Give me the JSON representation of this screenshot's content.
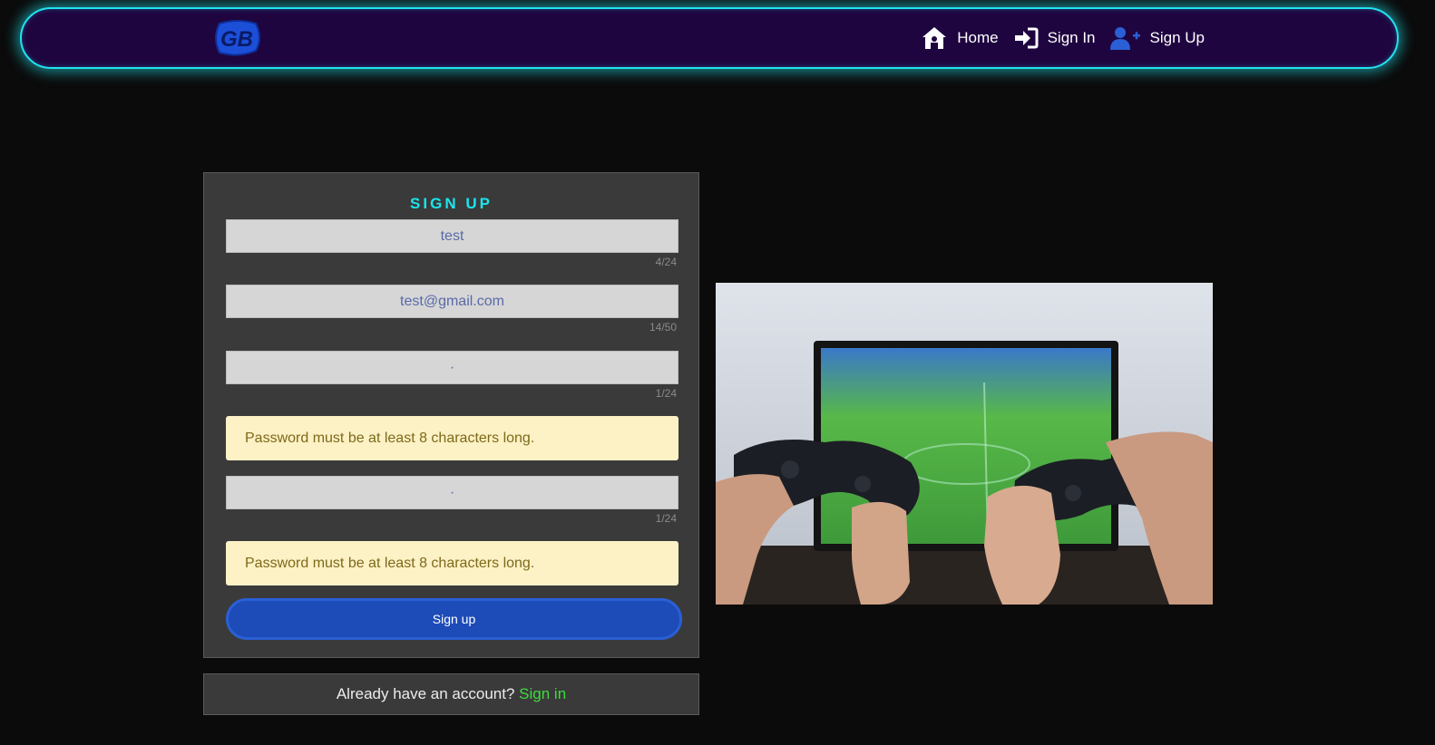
{
  "nav": {
    "logo_text": "GB",
    "links": [
      {
        "label": "Home",
        "icon": "home-icon"
      },
      {
        "label": "Sign In",
        "icon": "sign-in-icon"
      },
      {
        "label": "Sign Up",
        "icon": "user-plus-icon"
      }
    ]
  },
  "signup": {
    "title": "SIGN UP",
    "username": {
      "value": "test",
      "counter": "4/24"
    },
    "email": {
      "value": "test@gmail.com",
      "counter": "14/50"
    },
    "password": {
      "value": "·",
      "counter": "1/24",
      "error": "Password must be at least 8 characters long."
    },
    "confirm_password": {
      "value": "·",
      "counter": "1/24",
      "error": "Password must be at least 8 characters long."
    },
    "submit_label": "Sign up"
  },
  "footer": {
    "prompt": "Already have an account?",
    "link_label": "Sign in"
  },
  "colors": {
    "accent_cyan": "#19e6ee",
    "nav_bg": "#1f0540",
    "button_blue": "#1d4bb8",
    "link_green": "#3ddc3d",
    "alert_bg": "#fdf1c6"
  }
}
